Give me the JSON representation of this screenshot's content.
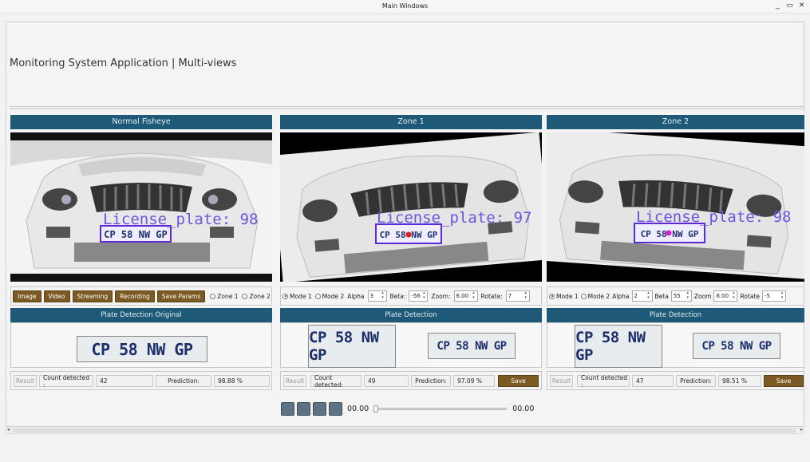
{
  "window": {
    "title": "Main Windows",
    "controls": [
      "_",
      "▭",
      "✕"
    ]
  },
  "app": {
    "title": "Monitoring System Application | Multi-views"
  },
  "panels": [
    {
      "header": "Normal Fisheye",
      "overlay_label": "License_plate: 98",
      "plate_text": "CP 58 NW GP",
      "buttons": [
        "Image",
        "Video",
        "Streaming",
        "Recording",
        "Save Params"
      ],
      "zones": [
        {
          "label": "Zone 1",
          "checked": false
        },
        {
          "label": "Zone 2",
          "checked": false
        }
      ],
      "detection_header": "Plate Detection Original",
      "result": {
        "result_label": "Result",
        "count_label": "Count detected :",
        "count": "42",
        "prediction_label": "Prediction:",
        "prediction": "98.88 %"
      }
    },
    {
      "header": "Zone 1",
      "overlay_label": "License_plate: 97",
      "plate_text": "CP 58 NW GP",
      "modes": [
        {
          "label": "Mode 1",
          "checked": true
        },
        {
          "label": "Mode 2",
          "checked": false
        }
      ],
      "params": [
        {
          "label": "Alpha",
          "value": "3"
        },
        {
          "label": "Beta:",
          "value": "-56"
        },
        {
          "label": "Zoom:",
          "value": "6.00"
        },
        {
          "label": "Rotate:",
          "value": "7"
        }
      ],
      "detection_header": "Plate Detection",
      "result": {
        "result_label": "Result",
        "count_label": "Count detected:",
        "count": "49",
        "prediction_label": "Prediction:",
        "prediction": "97.09 %",
        "save_label": "Save"
      }
    },
    {
      "header": "Zone 2",
      "overlay_label": "License_plate: 98",
      "plate_text": "CP 58 NW GP",
      "modes": [
        {
          "label": "Mode 1",
          "checked": true
        },
        {
          "label": "Mode 2",
          "checked": false
        }
      ],
      "params": [
        {
          "label": "Alpha",
          "value": "2"
        },
        {
          "label": "Beta",
          "value": "55"
        },
        {
          "label": "Zoom",
          "value": "6.00"
        },
        {
          "label": "Rotate",
          "value": "-5"
        }
      ],
      "detection_header": "Plate Detection",
      "result": {
        "result_label": "Result",
        "count_label": "Count detected :",
        "count": "47",
        "prediction_label": "Prediction:",
        "prediction": "98.51 %",
        "save_label": "Save"
      }
    }
  ],
  "player": {
    "time_start": "00.00",
    "time_end": "00.00",
    "progress": 0
  },
  "colors": {
    "header_bg": "#1e5a77",
    "button_gold": "#7a5a22",
    "detect_box": "#5a2bd6",
    "zone1_dot": "#e01b1b",
    "zone2_dot": "#e01be0"
  },
  "icons": {
    "player_buttons": [
      "play-icon",
      "pause-icon",
      "stop-icon",
      "record-icon"
    ]
  }
}
